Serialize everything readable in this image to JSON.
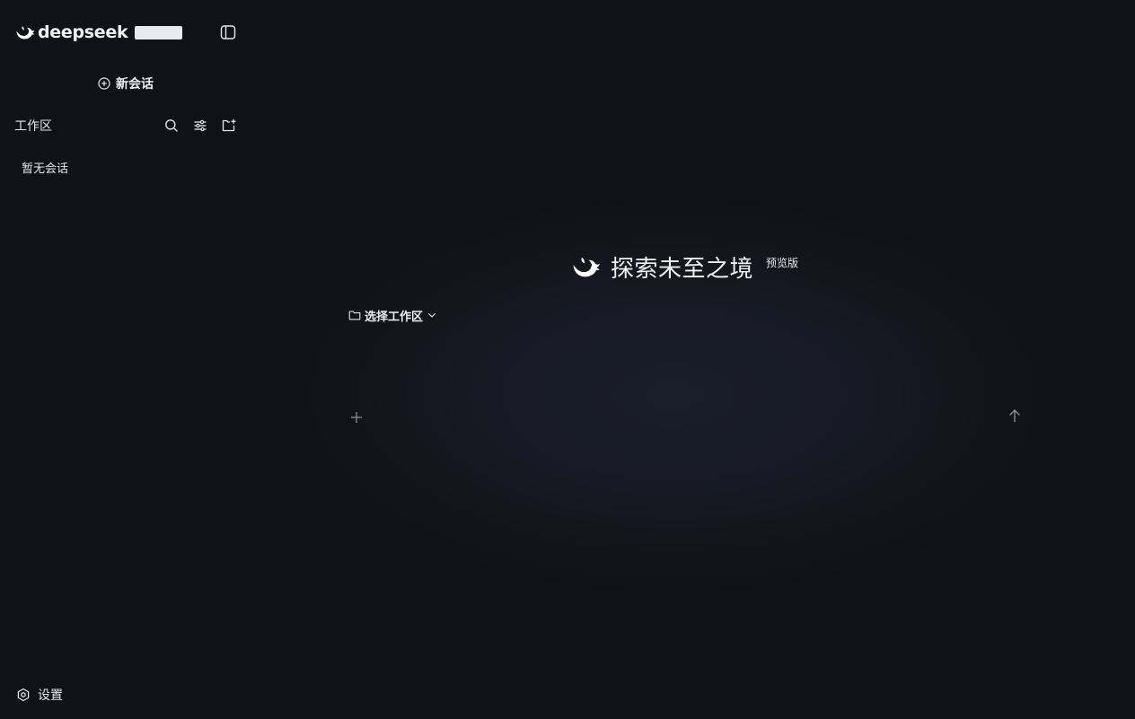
{
  "app": {
    "brand_name": "deepseek",
    "accent_color": "#4d6bfe"
  },
  "sidebar": {
    "new_chat_label": "新会话",
    "workspace_title": "工作区",
    "empty_label": "暂无会话",
    "settings_label": "设置",
    "tool_icons": [
      "search-icon",
      "filter-icon",
      "new-folder-icon"
    ]
  },
  "main": {
    "hero_title": "探索未至之境",
    "hero_badge": "预览版",
    "workspace_select_label": "选择工作区",
    "input_placeholder": ""
  }
}
